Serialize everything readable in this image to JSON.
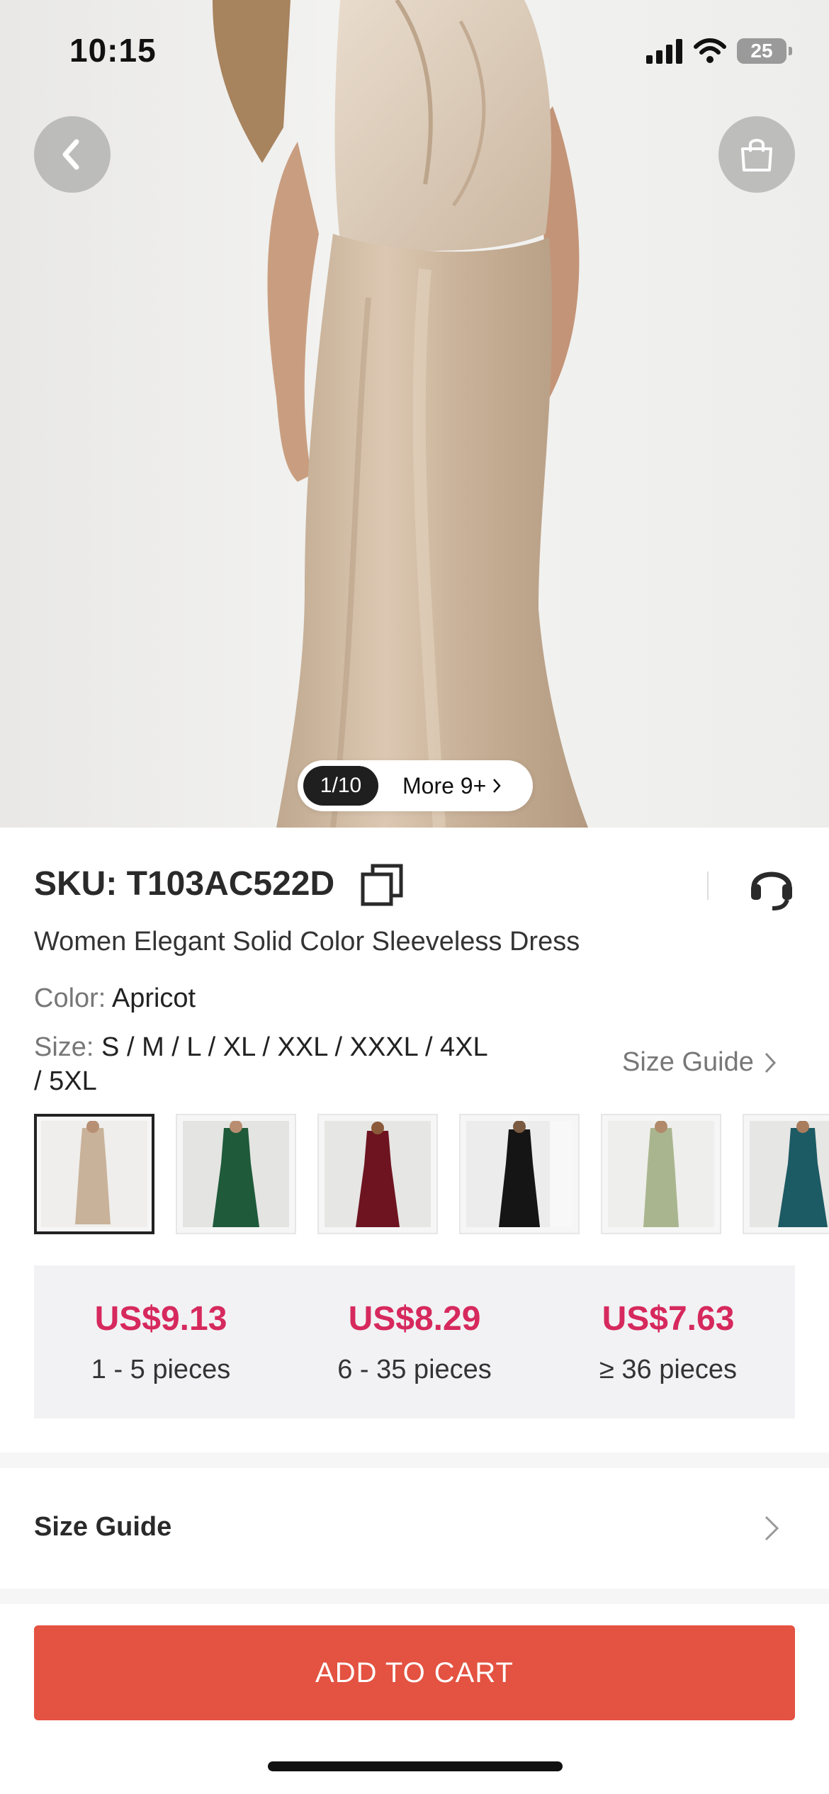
{
  "status_bar": {
    "time": "10:15",
    "battery": "25"
  },
  "gallery": {
    "counter": "1/10",
    "more_label": "More 9+"
  },
  "product": {
    "sku": "SKU: T103AC522D",
    "title": "Women Elegant Solid Color Sleeveless Dress",
    "color_label": "Color:",
    "color_value": "Apricot",
    "size_label": "Size:",
    "size_values": "S / M / L / XL / XXL / XXXL / 4XL / 5XL",
    "size_guide_link": "Size Guide"
  },
  "swatches": [
    {
      "name": "apricot",
      "color": "#c9b29a",
      "selected": true
    },
    {
      "name": "green",
      "color": "#1f5a3a",
      "selected": false
    },
    {
      "name": "burgundy",
      "color": "#6e1420",
      "selected": false
    },
    {
      "name": "black",
      "color": "#151515",
      "selected": false
    },
    {
      "name": "sage",
      "color": "#a9b58e",
      "selected": false
    },
    {
      "name": "teal",
      "color": "#1c5a64",
      "selected": false
    }
  ],
  "price_tiers": [
    {
      "price": "US$9.13",
      "qty": "1 - 5 pieces"
    },
    {
      "price": "US$8.29",
      "qty": "6 - 35 pieces"
    },
    {
      "price": "US$7.63",
      "qty": "≥ 36 pieces"
    }
  ],
  "size_guide_row": {
    "label": "Size Guide"
  },
  "actions": {
    "add_to_cart": "ADD TO CART"
  },
  "colors": {
    "accent": "#e45241",
    "price": "#d6295d"
  }
}
